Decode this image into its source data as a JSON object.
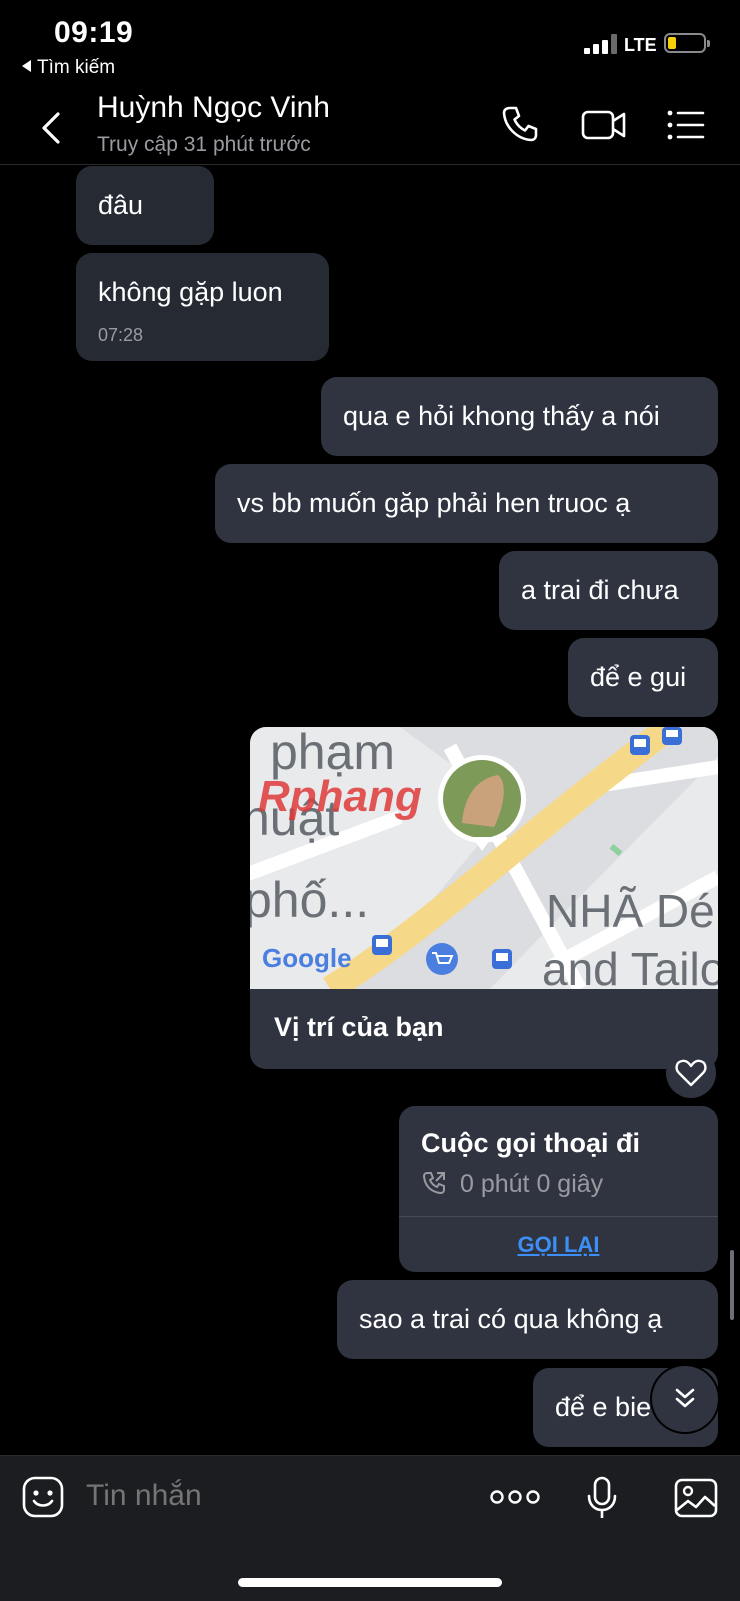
{
  "status_bar": {
    "time": "09:19",
    "back_label": "Tìm kiếm",
    "network": "LTE"
  },
  "header": {
    "name": "Huỳnh Ngọc Vinh",
    "last_seen": "Truy cập 31 phút trước"
  },
  "messages": [
    {
      "dir": "in",
      "text": "đâu"
    },
    {
      "dir": "in",
      "text": "không gặp luon",
      "time": "07:28"
    },
    {
      "dir": "out",
      "text": "qua e hỏi khong thấy a nói"
    },
    {
      "dir": "out",
      "text": "vs bb  muốn găp phải hen truoc ạ"
    },
    {
      "dir": "out",
      "text": "a trai đi chưa"
    },
    {
      "dir": "out",
      "text": "để e gui"
    },
    {
      "dir": "out",
      "text": "sao a trai có qua không ạ"
    },
    {
      "dir": "out",
      "text": "để e bie"
    }
  ],
  "map_card": {
    "caption": "Vị trí của bạn",
    "map_labels": [
      "phạm",
      "huật",
      "phố...",
      "NHÃ Dé",
      "and Tailo",
      "Google"
    ],
    "watermark": "Rphang"
  },
  "call_card": {
    "title": "Cuộc gọi thoại đi",
    "duration": "0 phút 0 giây",
    "action": "GỌI LẠI"
  },
  "composer": {
    "placeholder": "Tin nhắn"
  },
  "colors": {
    "bubble_out": "#2f3440",
    "bubble_in": "#262a33",
    "link": "#3d8ff5",
    "map_road": "#f6d889"
  }
}
